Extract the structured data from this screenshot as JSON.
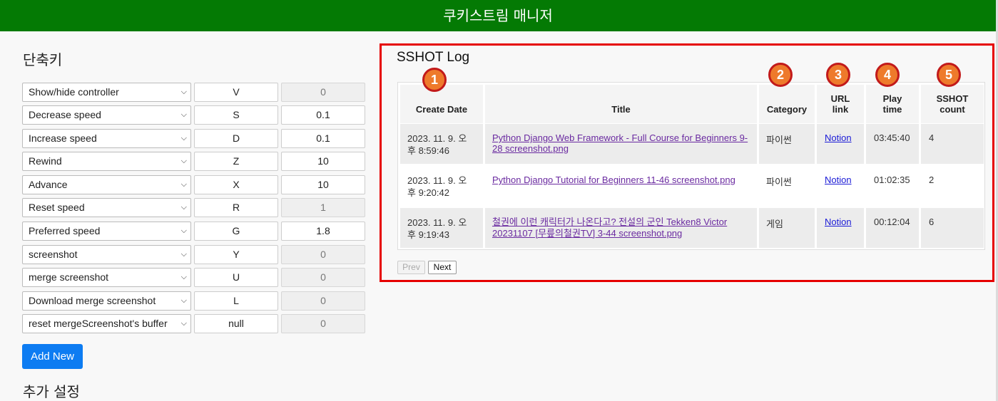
{
  "header": {
    "title": "쿠키스트림 매니저"
  },
  "shortcuts": {
    "title": "단축키",
    "rows": [
      {
        "action": "Show/hide controller",
        "key": "V",
        "value": "0"
      },
      {
        "action": "Decrease speed",
        "key": "S",
        "value": "0.1"
      },
      {
        "action": "Increase speed",
        "key": "D",
        "value": "0.1"
      },
      {
        "action": "Rewind",
        "key": "Z",
        "value": "10"
      },
      {
        "action": "Advance",
        "key": "X",
        "value": "10"
      },
      {
        "action": "Reset speed",
        "key": "R",
        "value": "1"
      },
      {
        "action": "Preferred speed",
        "key": "G",
        "value": "1.8"
      },
      {
        "action": "screenshot",
        "key": "Y",
        "value": "0"
      },
      {
        "action": "merge screenshot",
        "key": "U",
        "value": "0"
      },
      {
        "action": "Download merge screenshot",
        "key": "L",
        "value": "0"
      },
      {
        "action": "reset mergeScreenshot's buffer",
        "key": "null",
        "value": "0"
      }
    ],
    "add_button": "Add New",
    "extra_title": "추가 설정"
  },
  "log": {
    "title": "SSHOT Log",
    "columns": {
      "create_date": "Create Date",
      "title": "Title",
      "category": "Category",
      "url_1": "URL",
      "url_2": "link",
      "play_1": "Play",
      "play_2": "time",
      "count_1": "SSHOT",
      "count_2": "count"
    },
    "rows": [
      {
        "date_1": "2023. 11. 9. 오",
        "date_2": "후 8:59:46",
        "title_1": "Python Django Web Framework - Full Course for Beginners 9-",
        "title_2": "28 screenshot.png",
        "category": "파이썬",
        "url": "Notion",
        "play_time": "03:45:40",
        "count": "4"
      },
      {
        "date_1": "2023. 11. 9. 오",
        "date_2": "후 9:20:42",
        "title_1": "Python Django Tutorial for Beginners 11-46 screenshot.png",
        "title_2": "",
        "category": "파이썬",
        "url": "Notion",
        "play_time": "01:02:35",
        "count": "2"
      },
      {
        "date_1": "2023. 11. 9. 오",
        "date_2": "후 9:19:43",
        "title_1": "철권에 이런 캐릭터가 나온다고? 전설의 군인 Tekken8 Victor",
        "title_2": "20231107 [무릎의철권TV] 3-44 screenshot.png",
        "category": "게임",
        "url": "Notion",
        "play_time": "00:12:04",
        "count": "6"
      }
    ],
    "badges": [
      "1",
      "2",
      "3",
      "4",
      "5"
    ],
    "prev": "Prev",
    "next": "Next"
  },
  "colors": {
    "header_bg": "#047a04",
    "accent_button": "#0d7cf2",
    "highlight_border": "#e60000",
    "badge_fill": "#ee7a2b"
  }
}
